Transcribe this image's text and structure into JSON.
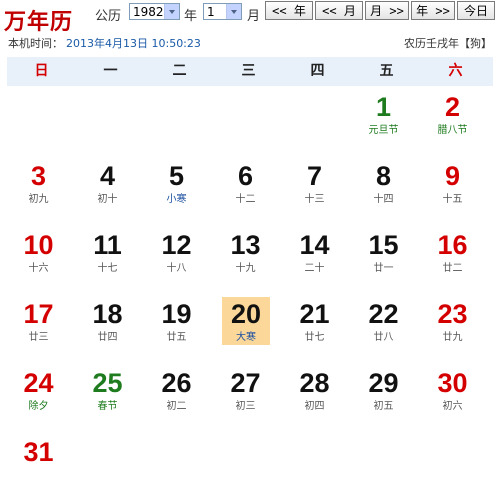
{
  "app": {
    "title": "万年历"
  },
  "controls": {
    "calendar_type": "公历",
    "year_value": "1982",
    "year_unit": "年",
    "month_value": "1",
    "month_unit": "月",
    "prev_year": "<< 年",
    "prev_month": "<< 月",
    "next_month": "月 >>",
    "next_year": "年 >>",
    "today": "今日"
  },
  "info": {
    "local_label": "本机时间：",
    "local_time": "2013年4月13日 10:50:23",
    "lunar_year": "农历壬戌年【狗】"
  },
  "weekdays": [
    "日",
    "一",
    "二",
    "三",
    "四",
    "五",
    "六"
  ],
  "days": [
    {
      "day": "1",
      "lunar": "元旦节",
      "col": 5,
      "row": 0,
      "day_color": "green",
      "lunar_color": "green"
    },
    {
      "day": "2",
      "lunar": "腊八节",
      "col": 6,
      "row": 0,
      "day_color": "red",
      "lunar_color": "green"
    },
    {
      "day": "3",
      "lunar": "初九",
      "col": 0,
      "row": 1,
      "day_color": "red",
      "lunar_color": "gray"
    },
    {
      "day": "4",
      "lunar": "初十",
      "col": 1,
      "row": 1,
      "day_color": "black",
      "lunar_color": "gray"
    },
    {
      "day": "5",
      "lunar": "小寒",
      "col": 2,
      "row": 1,
      "day_color": "black",
      "lunar_color": "blue"
    },
    {
      "day": "6",
      "lunar": "十二",
      "col": 3,
      "row": 1,
      "day_color": "black",
      "lunar_color": "gray"
    },
    {
      "day": "7",
      "lunar": "十三",
      "col": 4,
      "row": 1,
      "day_color": "black",
      "lunar_color": "gray"
    },
    {
      "day": "8",
      "lunar": "十四",
      "col": 5,
      "row": 1,
      "day_color": "black",
      "lunar_color": "gray"
    },
    {
      "day": "9",
      "lunar": "十五",
      "col": 6,
      "row": 1,
      "day_color": "red",
      "lunar_color": "gray"
    },
    {
      "day": "10",
      "lunar": "十六",
      "col": 0,
      "row": 2,
      "day_color": "red",
      "lunar_color": "gray"
    },
    {
      "day": "11",
      "lunar": "十七",
      "col": 1,
      "row": 2,
      "day_color": "black",
      "lunar_color": "gray"
    },
    {
      "day": "12",
      "lunar": "十八",
      "col": 2,
      "row": 2,
      "day_color": "black",
      "lunar_color": "gray"
    },
    {
      "day": "13",
      "lunar": "十九",
      "col": 3,
      "row": 2,
      "day_color": "black",
      "lunar_color": "gray"
    },
    {
      "day": "14",
      "lunar": "二十",
      "col": 4,
      "row": 2,
      "day_color": "black",
      "lunar_color": "gray"
    },
    {
      "day": "15",
      "lunar": "廿一",
      "col": 5,
      "row": 2,
      "day_color": "black",
      "lunar_color": "gray"
    },
    {
      "day": "16",
      "lunar": "廿二",
      "col": 6,
      "row": 2,
      "day_color": "red",
      "lunar_color": "gray"
    },
    {
      "day": "17",
      "lunar": "廿三",
      "col": 0,
      "row": 3,
      "day_color": "red",
      "lunar_color": "gray"
    },
    {
      "day": "18",
      "lunar": "廿四",
      "col": 1,
      "row": 3,
      "day_color": "black",
      "lunar_color": "gray"
    },
    {
      "day": "19",
      "lunar": "廿五",
      "col": 2,
      "row": 3,
      "day_color": "black",
      "lunar_color": "gray"
    },
    {
      "day": "20",
      "lunar": "大寒",
      "col": 3,
      "row": 3,
      "day_color": "black",
      "lunar_color": "blue",
      "today": true
    },
    {
      "day": "21",
      "lunar": "廿七",
      "col": 4,
      "row": 3,
      "day_color": "black",
      "lunar_color": "gray"
    },
    {
      "day": "22",
      "lunar": "廿八",
      "col": 5,
      "row": 3,
      "day_color": "black",
      "lunar_color": "gray"
    },
    {
      "day": "23",
      "lunar": "廿九",
      "col": 6,
      "row": 3,
      "day_color": "red",
      "lunar_color": "gray"
    },
    {
      "day": "24",
      "lunar": "除夕",
      "col": 0,
      "row": 4,
      "day_color": "red",
      "lunar_color": "green"
    },
    {
      "day": "25",
      "lunar": "春节",
      "col": 1,
      "row": 4,
      "day_color": "green",
      "lunar_color": "green"
    },
    {
      "day": "26",
      "lunar": "初二",
      "col": 2,
      "row": 4,
      "day_color": "black",
      "lunar_color": "gray"
    },
    {
      "day": "27",
      "lunar": "初三",
      "col": 3,
      "row": 4,
      "day_color": "black",
      "lunar_color": "gray"
    },
    {
      "day": "28",
      "lunar": "初四",
      "col": 4,
      "row": 4,
      "day_color": "black",
      "lunar_color": "gray"
    },
    {
      "day": "29",
      "lunar": "初五",
      "col": 5,
      "row": 4,
      "day_color": "black",
      "lunar_color": "gray"
    },
    {
      "day": "30",
      "lunar": "初六",
      "col": 6,
      "row": 4,
      "day_color": "red",
      "lunar_color": "gray"
    },
    {
      "day": "31",
      "lunar": "",
      "col": 0,
      "row": 5,
      "day_color": "red",
      "lunar_color": "gray"
    }
  ],
  "colors": {
    "red": "#d40000",
    "green": "#1e7b1e",
    "blue": "#1c4fa0",
    "today_bg": "#fbd89a",
    "header_bg": "#e8f1fa"
  }
}
